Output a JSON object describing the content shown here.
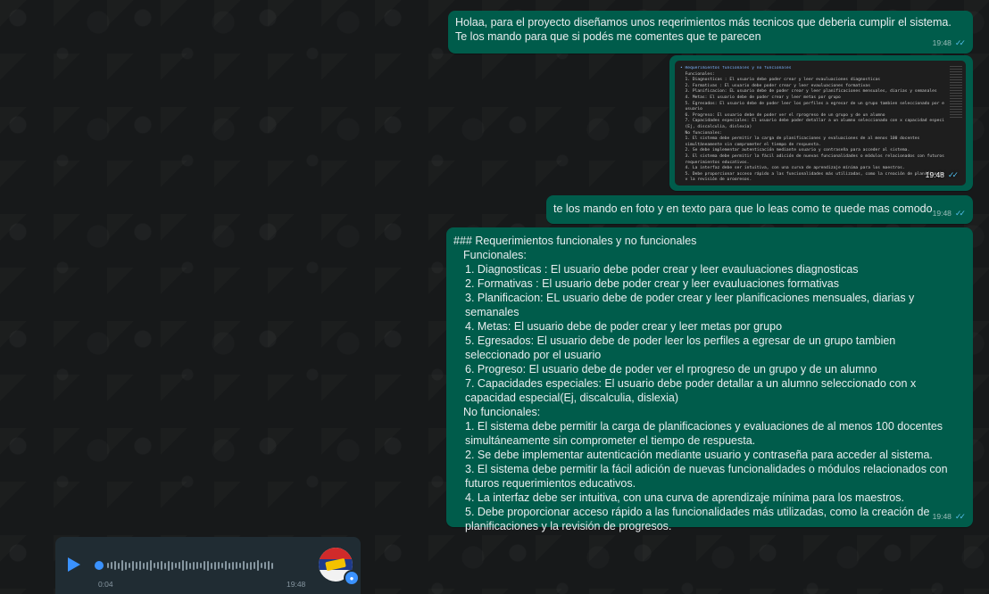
{
  "messages": [
    {
      "text": "Holaa, para el proyecto diseñamos unos reqerimientos más tecnicos que deberia cumplir el sistema. Te los mando para que si podés me comentes que te parecen",
      "time": "19:48",
      "status_icon": "double-check-read"
    },
    {
      "type": "image",
      "time": "19:48",
      "status_icon": "double-check-read",
      "image_lines": [
        "• Requerimientos funcionales y no funcionales",
        "  Funcionales:",
        "  1. Diagnosticas : El usuario debe poder crear y leer evauluaciones diagnosticas",
        "  2. Formativas : El usuario debe poder crear y leer evauluaciones formativas",
        "  3. Planificacion: EL usuario debe de poder crear y leer planificaciones mensuales, diarias y semanales",
        "  4. Metas: El usuario debe de poder crear y leer metas por grupo",
        "  5. Egresados: El usuario debe de poder leer los perfiles a egresar de un grupo tambien seleccionado por el",
        "  usuario",
        "  6. Progreso: El usuario debe de poder ver el rprogreso de un grupo y de un alumno",
        "  7. Capacidades especiales: El usuario debe poder detallar a un alumno seleccionado con x capacidad especial",
        "  (Ej, discalculia, dislexia)",
        "  No funcionales:",
        "  1. El sistema debe permitir la carga de planificaciones y evaluaciones de al menos 100 docentes",
        "  simultáneamente sin comprometer el tiempo de respuesta.",
        "  2. Se debe implementar autenticación mediante usuario y contraseña para acceder al sistema.",
        "  3. El sistema debe permitir la fácil adición de nuevas funcionalidades o módulos relacionados con futuros",
        "  requerimientos educativos.",
        "  4. La interfaz debe ser intuitiva, con una curva de aprendizaje mínima para los maestros.",
        "  5. Debe proporcionar acceso rápido a las funcionalidades más utilizadas, como la creación de planificaciones",
        "  y la revisión de progresos."
      ]
    },
    {
      "text": "te los mando en foto y en texto para que lo leas como te quede mas comodo",
      "time": "19:48",
      "status_icon": "double-check-read"
    },
    {
      "time": "19:48",
      "status_icon": "double-check-read",
      "heading": "### Requerimientos funcionales y no funcionales",
      "functional_title": "Funcionales:",
      "functional": [
        "1. Diagnosticas : El usuario debe poder crear y leer evauluaciones diagnosticas",
        "2. Formativas : El usuario debe poder crear y leer evauluaciones formativas",
        "3. Planificacion: EL usuario debe de poder crear y leer planificaciones mensuales, diarias y semanales",
        "4. Metas: El usuario debe de poder crear y leer metas por grupo",
        "5. Egresados: El usuario debe de poder leer los perfiles a egresar de un grupo tambien seleccionado por el usuario",
        "6. Progreso: El usuario debe de poder ver el rprogreso de un grupo y de un alumno",
        "7. Capacidades especiales: El usuario debe poder detallar a un alumno seleccionado con x capacidad especial(Ej, discalculia, dislexia)"
      ],
      "nonfunctional_title": "No funcionales:",
      "nonfunctional": [
        "1. El sistema debe permitir la carga de planificaciones y evaluaciones de al menos 100 docentes simultáneamente sin comprometer el tiempo de respuesta.",
        "2. Se debe implementar autenticación mediante usuario y contraseña para acceder al sistema.",
        "3. El sistema debe permitir la fácil adición de nuevas funcionalidades o módulos relacionados con futuros requerimientos educativos.",
        "4. La interfaz debe ser intuitiva, con una curva de aprendizaje mínima para los maestros.",
        "5. Debe proporcionar acceso rápido a las funcionalidades más utilizadas, como la creación de planificaciones y la revisión de progresos."
      ]
    }
  ],
  "voice_message": {
    "duration": "0:04",
    "time": "19:48",
    "play_icon": "play-icon",
    "mic_icon": "mic-icon"
  },
  "colors": {
    "outgoing_bubble": "#005c4b",
    "incoming_bubble": "#202c33",
    "read_ticks": "#53bdeb",
    "accent": "#3a92ff"
  }
}
